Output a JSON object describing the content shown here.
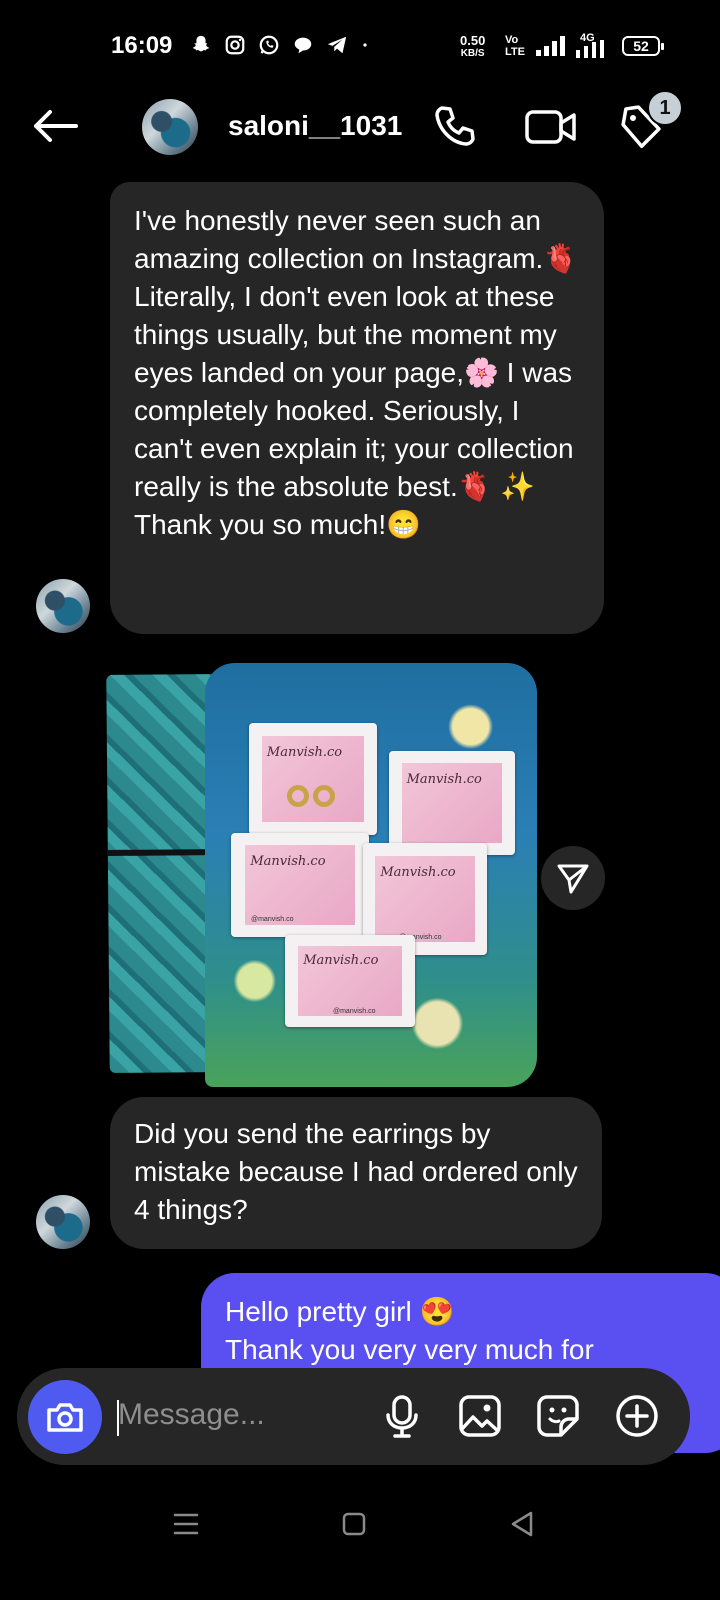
{
  "status_bar": {
    "time": "16:09",
    "net_speed_value": "0.50",
    "net_speed_unit": "KB/S",
    "volte_top": "Vo",
    "volte_bottom": "LTE",
    "network": "4G",
    "battery": "52"
  },
  "header": {
    "username": "saloni__1031",
    "badge_count": "1"
  },
  "messages": [
    {
      "sender": "saloni__1031",
      "text": "I've honestly never seen such an amazing collection on Instagram.🫀 Literally, I don't even look at these things usually, but the moment my eyes landed on your page,🌸 I was completely hooked. Seriously, I can't even explain it; your collection really is the absolute best.🫀 ✨ Thank you so much!😁"
    },
    {
      "sender": "saloni__1031",
      "type": "photo",
      "card_brand": "Manvish.co",
      "card_handle": "@manvish.co"
    },
    {
      "sender": "saloni__1031",
      "text": "Did you send the earrings by mistake because I had ordered only 4 things?"
    },
    {
      "sender": "me",
      "text_line1": "Hello pretty girl 😍",
      "text_line2": "Thank you very very much for"
    }
  ],
  "composer": {
    "placeholder": "Message..."
  },
  "colors": {
    "incoming_bubble": "#262626",
    "outgoing_bubble": "#5a4ff0",
    "camera_button": "#4f5bf0"
  }
}
